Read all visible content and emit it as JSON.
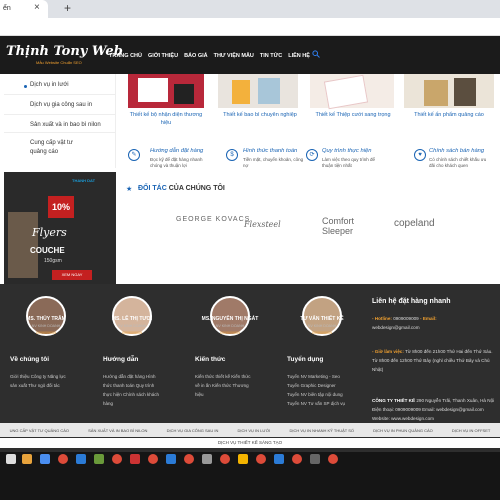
{
  "browser": {
    "tab_title": "ển",
    "tab_close": "×",
    "new_tab": "+"
  },
  "header": {
    "logo": "Thịnh Tony Web",
    "logo_sub": "Mẫu Website Chuẩn SEO",
    "nav": [
      "TRANG CHỦ",
      "GIỚI THIỆU",
      "BÁO GIÁ",
      "THƯ VIỆN MẪU",
      "TIN TỨC",
      "LIÊN HỆ"
    ],
    "search_icon": "search-icon"
  },
  "sidebar": {
    "items": [
      "Dịch vụ in lưới",
      "Dịch vụ gia công sau in",
      "Sản xuất và in bao bì nilon",
      "Cung cấp vật tư quảng cáo"
    ]
  },
  "ad": {
    "badge": "10%",
    "logo": "THANH DAT",
    "title1": "Flyers",
    "title2": "COUCHE",
    "gsm": "150gsm",
    "button": "XEM NGAY"
  },
  "products": [
    {
      "label": "Thiết kế bộ nhận diện thương hiệu"
    },
    {
      "label": "Thiết kế bao bì chuyên nghiệp"
    },
    {
      "label": "Thiết kế Thiệp cưới sang trọng"
    },
    {
      "label": "Thiết kế ấn phẩm quảng cáo"
    }
  ],
  "services": [
    {
      "title": "Hướng dẫn đặt hàng",
      "desc": "Đọc kỹ để đặt hàng nhanh chóng và thuận lợi"
    },
    {
      "title": "Hình thức thanh toán",
      "desc": "Tiền mặt, chuyển khoản, công nợ"
    },
    {
      "title": "Quy trình thực hiện",
      "desc": "Làm việc theo quy trình để thuận tiện nhất"
    },
    {
      "title": "Chính sách bán hàng",
      "desc": "Có chính sách chiết khấu ưu đãi cho khách quen"
    }
  ],
  "partners": {
    "star": "★",
    "title_pre": "ĐỐI TÁC",
    "title_post": "CỦA CHÚNG TÔI",
    "logos": [
      "GEORGE KOVACS",
      "Flexsteel",
      "Comfort Sleeper",
      "copeland"
    ]
  },
  "team": [
    {
      "name": "MS. THỦY TRÂM",
      "role": "NV KINH DOANH",
      "phone": "0909009009"
    },
    {
      "name": "MS. LÊ THỊ TƯƠI",
      "role": "NV KINH DOANH",
      "phone": "0909009009"
    },
    {
      "name": "MS. NGUYỄN THỊ NGÁT",
      "role": "NV KINH DOANH",
      "phone": "0909009009"
    },
    {
      "name": "TƯ VẤN THIẾT KẾ",
      "role": "NV KINH DOANH",
      "phone": "0909009009"
    }
  ],
  "footer_cols": [
    {
      "title": "Về chúng tôi",
      "lines": [
        "Giới thiệu Công ty Năng lực",
        "sản xuất Thư ngỏ đối tác"
      ]
    },
    {
      "title": "Hướng dẫn",
      "lines": [
        "Hướng dẫn đặt hàng Hình",
        "thức thanh toán Quy trình",
        "thực hiện Chính sách khách",
        "hàng"
      ]
    },
    {
      "title": "Kiến thức",
      "lines": [
        "Kiến thức thiết kế Kiến thức",
        "về in ấn Kiến thức Thương",
        "hiệu"
      ]
    },
    {
      "title": "Tuyển dụng",
      "lines": [
        "Tuyển NV Marketing - Seo",
        "Tuyển Graphic Designer",
        "Tuyển NV biên tập nội dung",
        "Tuyển NV Tư vấn SP dịch vụ"
      ]
    }
  ],
  "contact": {
    "title": "Liên hệ đặt hàng nhanh",
    "hotline_label": "- Hotline:",
    "hotline": "0909009009",
    "email_label": "- Email:",
    "email": "webdesign@gmail.com",
    "hours_label": "- Giờ làm việc:",
    "hours": "Từ 8h00 đến 21h00 Thứ Hai đến Thứ Sáu. Từ 8h00 đến 12h00 Thứ Bảy (nghỉ chiều Thứ Bảy và Chủ Nhật)",
    "company_label": "CÔNG TY THIẾT KẾ",
    "company": "290 Nguyễn Trãi, Thanh Xuân, Hà Nội Điện thoại:",
    "company_phone": "0909009009",
    "company_email": "Email: webdesign@gmail.com Website:",
    "website": "www.webdesign.com"
  },
  "bottom_links": [
    "UNG CẤP VẬT TƯ QUẢNG CÁO",
    "SẢN XUẤT VÀ IN BAO BÌ NILON",
    "DỊCH VỤ GIA CÔNG SAU IN",
    "DỊCH VỤ IN LƯỚI",
    "DỊCH VỤ IN NHANH KỸ THUẬT SỐ",
    "DỊCH VỤ IN PHUN QUẢNG CÁO",
    "DỊCH VỤ IN OFFSET"
  ],
  "bottom_link2": "DỊCH VỤ THIẾT KẾ SÁNG TẠO",
  "colors": {
    "accent": "#1a64b4",
    "dark": "#1b1b1b",
    "orange": "#f0a030",
    "red": "#c42020"
  }
}
